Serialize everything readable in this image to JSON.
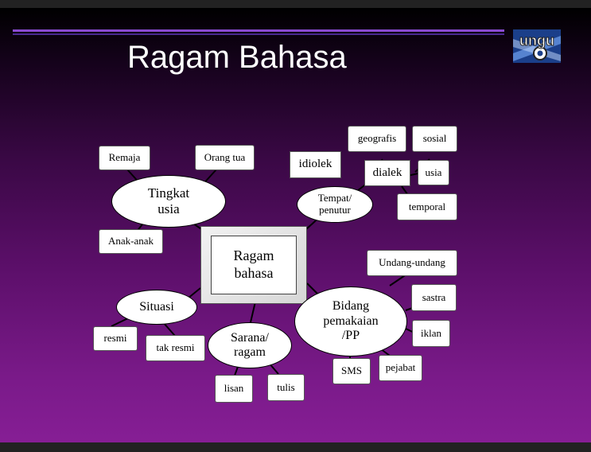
{
  "title": "Ragam Bahasa",
  "logo_text": "ungu",
  "center": "Ragam\nbahasa",
  "hubs": {
    "tingkat": "Tingkat\nusia",
    "tempat": "Tempat/\npenutur",
    "situasi": "Situasi",
    "sarana": "Sarana/\nragam",
    "bidang": "Bidang\npemakaian\n/PP"
  },
  "leaves": {
    "remaja": "Remaja",
    "orangtua": "Orang tua",
    "anakanak": "Anak-anak",
    "idiolek": "idiolek",
    "dialek": "dialek",
    "geografis": "geografis",
    "sosial": "sosial",
    "usia": "usia",
    "temporal": "temporal",
    "undang": "Undang-undang",
    "sastra": "sastra",
    "iklan": "iklan",
    "pejabat": "pejabat",
    "sms": "SMS",
    "resmi": "resmi",
    "takresmi": "tak resmi",
    "lisan": "lisan",
    "tulis": "tulis"
  },
  "colors": {
    "background_top": "#000000",
    "background_bottom": "#861e95",
    "rule": "#8a4ad0",
    "title": "#ffffff"
  }
}
